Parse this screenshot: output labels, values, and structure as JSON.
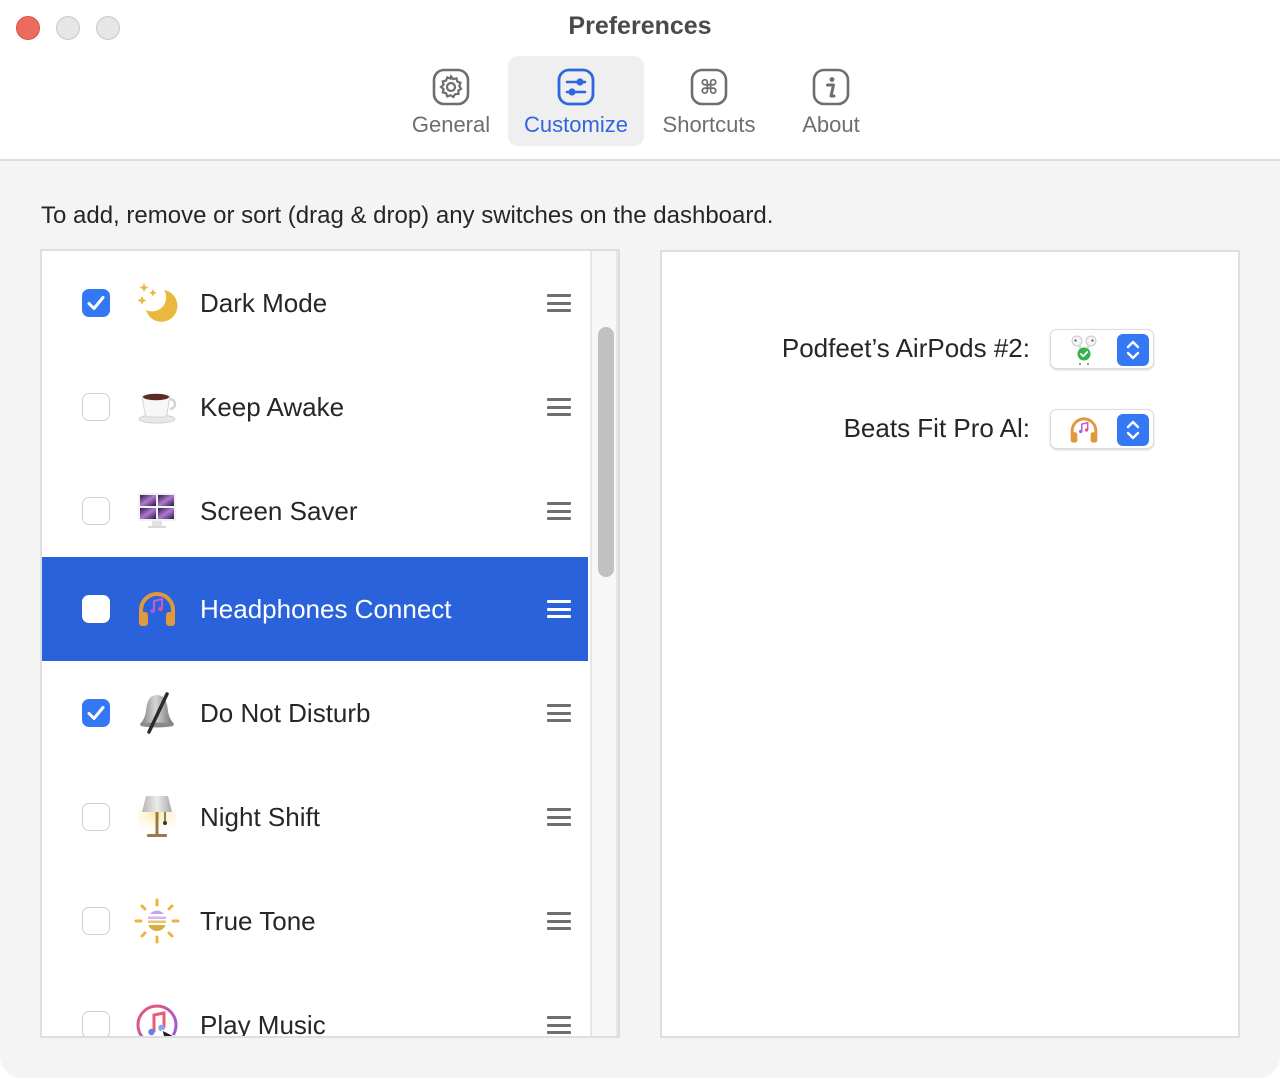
{
  "window": {
    "title": "Preferences",
    "controls": [
      "close",
      "minimize",
      "zoom"
    ],
    "colors": {
      "close": "#ed6a5e",
      "inactive": "#e6e6e6",
      "accent": "#2f66e0",
      "selection": "#2a62db",
      "checkbox": "#3478f6"
    }
  },
  "tabs": [
    {
      "label": "General",
      "icon": "gear-icon",
      "active": false
    },
    {
      "label": "Customize",
      "icon": "sliders-icon",
      "active": true
    },
    {
      "label": "Shortcuts",
      "icon": "command-icon",
      "active": false
    },
    {
      "label": "About",
      "icon": "info-icon",
      "active": false
    }
  ],
  "customize": {
    "instruction": "To add, remove or sort (drag & drop) any switches on the dashboard.",
    "switches": [
      {
        "label": "Dark Mode",
        "icon": "moon-stars-icon",
        "checked": true,
        "selected": false
      },
      {
        "label": "Keep Awake",
        "icon": "coffee-cup-icon",
        "checked": false,
        "selected": false
      },
      {
        "label": "Screen Saver",
        "icon": "monitor-icon",
        "checked": false,
        "selected": false
      },
      {
        "label": "Headphones Connect",
        "icon": "headphones-icon",
        "checked": false,
        "selected": true
      },
      {
        "label": "Do Not Disturb",
        "icon": "bell-slash-icon",
        "checked": true,
        "selected": false
      },
      {
        "label": "Night Shift",
        "icon": "lamp-icon",
        "checked": false,
        "selected": false
      },
      {
        "label": "True Tone",
        "icon": "sun-icon",
        "checked": false,
        "selected": false
      },
      {
        "label": "Play Music",
        "icon": "music-icon",
        "checked": false,
        "selected": false
      }
    ],
    "devices": [
      {
        "label": "Podfeet’s AirPods #2:",
        "icon": "airpods-connected-icon"
      },
      {
        "label": "Beats Fit Pro Al:",
        "icon": "headphones-icon"
      }
    ]
  }
}
